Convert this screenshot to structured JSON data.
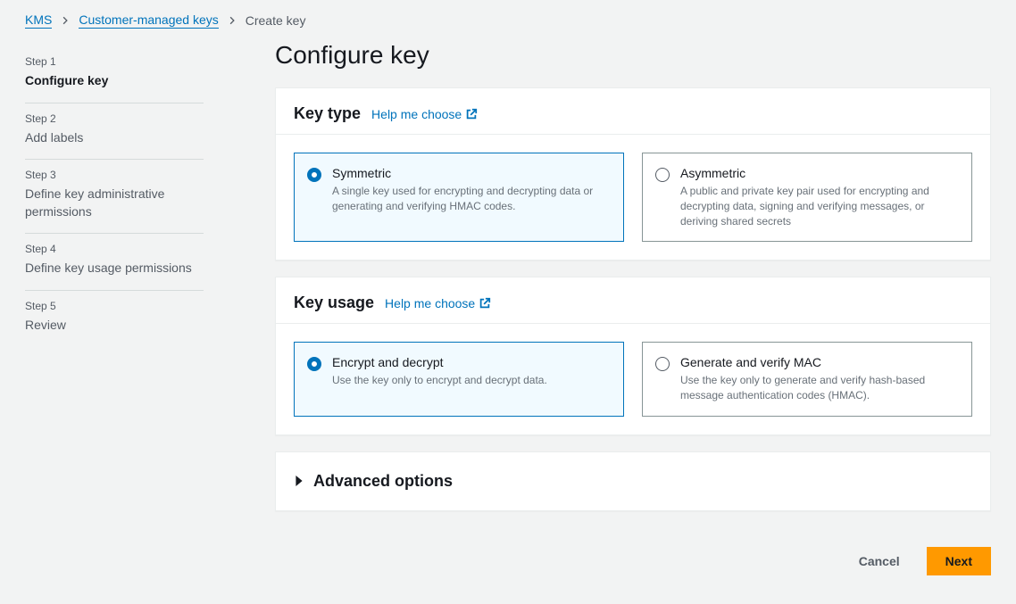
{
  "breadcrumb": {
    "items": [
      {
        "label": "KMS",
        "link": true
      },
      {
        "label": "Customer-managed keys",
        "link": true
      },
      {
        "label": "Create key",
        "link": false
      }
    ]
  },
  "steps": [
    {
      "num": "Step 1",
      "title": "Configure key",
      "active": true
    },
    {
      "num": "Step 2",
      "title": "Add labels",
      "active": false
    },
    {
      "num": "Step 3",
      "title": "Define key administrative permissions",
      "active": false
    },
    {
      "num": "Step 4",
      "title": "Define key usage permissions",
      "active": false
    },
    {
      "num": "Step 5",
      "title": "Review",
      "active": false
    }
  ],
  "page_title": "Configure key",
  "sections": {
    "key_type": {
      "heading": "Key type",
      "help": "Help me choose",
      "options": [
        {
          "title": "Symmetric",
          "desc": "A single key used for encrypting and decrypting data or generating and verifying HMAC codes.",
          "selected": true
        },
        {
          "title": "Asymmetric",
          "desc": "A public and private key pair used for encrypting and decrypting data, signing and verifying messages, or deriving shared secrets",
          "selected": false
        }
      ]
    },
    "key_usage": {
      "heading": "Key usage",
      "help": "Help me choose",
      "options": [
        {
          "title": "Encrypt and decrypt",
          "desc": "Use the key only to encrypt and decrypt data.",
          "selected": true
        },
        {
          "title": "Generate and verify MAC",
          "desc": "Use the key only to generate and verify hash-based message authentication codes (HMAC).",
          "selected": false
        }
      ]
    },
    "advanced": "Advanced options"
  },
  "footer": {
    "cancel": "Cancel",
    "next": "Next"
  }
}
